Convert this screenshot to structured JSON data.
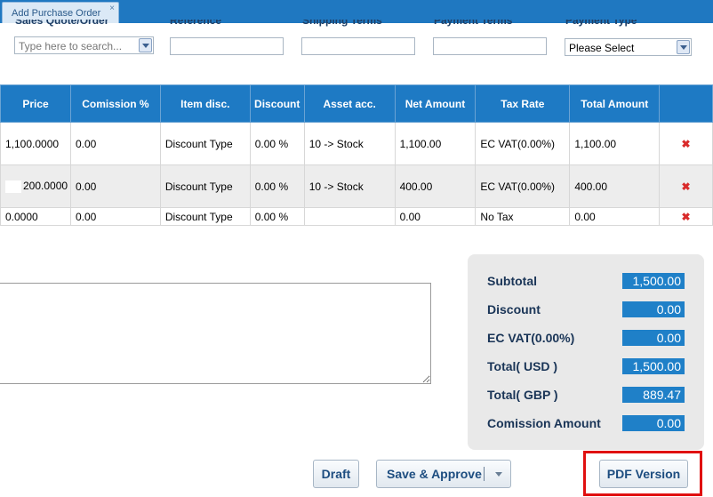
{
  "tab": {
    "label": "Add Purchase Order",
    "close": "×"
  },
  "fields": {
    "sales_quote": {
      "label": "Sales Quote/Order",
      "placeholder": "Type here to search..."
    },
    "reference": {
      "label": "Reference",
      "value": ""
    },
    "shipping_terms": {
      "label": "Shipping Terms",
      "value": ""
    },
    "payment_terms": {
      "label": "Payment Terms",
      "value": ""
    },
    "payment_type": {
      "label": "Payment Type",
      "selected": "Please Select"
    }
  },
  "table": {
    "headers": [
      "Price",
      "Comission %",
      "Item disc.",
      "Discount",
      "Asset acc.",
      "Net Amount",
      "Tax Rate",
      "Total Amount",
      ""
    ],
    "rows": [
      {
        "price": "1,100.0000",
        "comission": "0.00",
        "item_disc": "Discount Type",
        "discount": "0.00 %",
        "asset": "10 -> Stock",
        "net": "1,100.00",
        "tax": "EC VAT(0.00%)",
        "total": "1,100.00"
      },
      {
        "price": "200.0000",
        "comission": "0.00",
        "item_disc": "Discount Type",
        "discount": "0.00 %",
        "asset": "10 -> Stock",
        "net": "400.00",
        "tax": "EC VAT(0.00%)",
        "total": "400.00"
      },
      {
        "price": "0.0000",
        "comission": "0.00",
        "item_disc": "Discount Type",
        "discount": "0.00 %",
        "asset": "",
        "net": "0.00",
        "tax": "No Tax",
        "total": "0.00"
      }
    ],
    "delete_icon": "✖"
  },
  "summary": {
    "subtotal": {
      "label": "Subtotal",
      "value": "1,500.00"
    },
    "discount": {
      "label": "Discount",
      "value": "0.00"
    },
    "vat": {
      "label": "EC VAT(0.00%)",
      "value": "0.00"
    },
    "total_usd": {
      "label": "Total( USD )",
      "value": "1,500.00"
    },
    "total_gbp": {
      "label": "Total( GBP )",
      "value": "889.47"
    },
    "comission": {
      "label": "Comission Amount",
      "value": "0.00"
    }
  },
  "buttons": {
    "draft": "Draft",
    "save_approve": "Save & Approve",
    "pdf": "PDF Version"
  },
  "colors": {
    "header_blue": "#1e7ac4",
    "tab_bar": "#1f78c1",
    "highlight": "#e01010",
    "delete_red": "#d92b2b"
  }
}
